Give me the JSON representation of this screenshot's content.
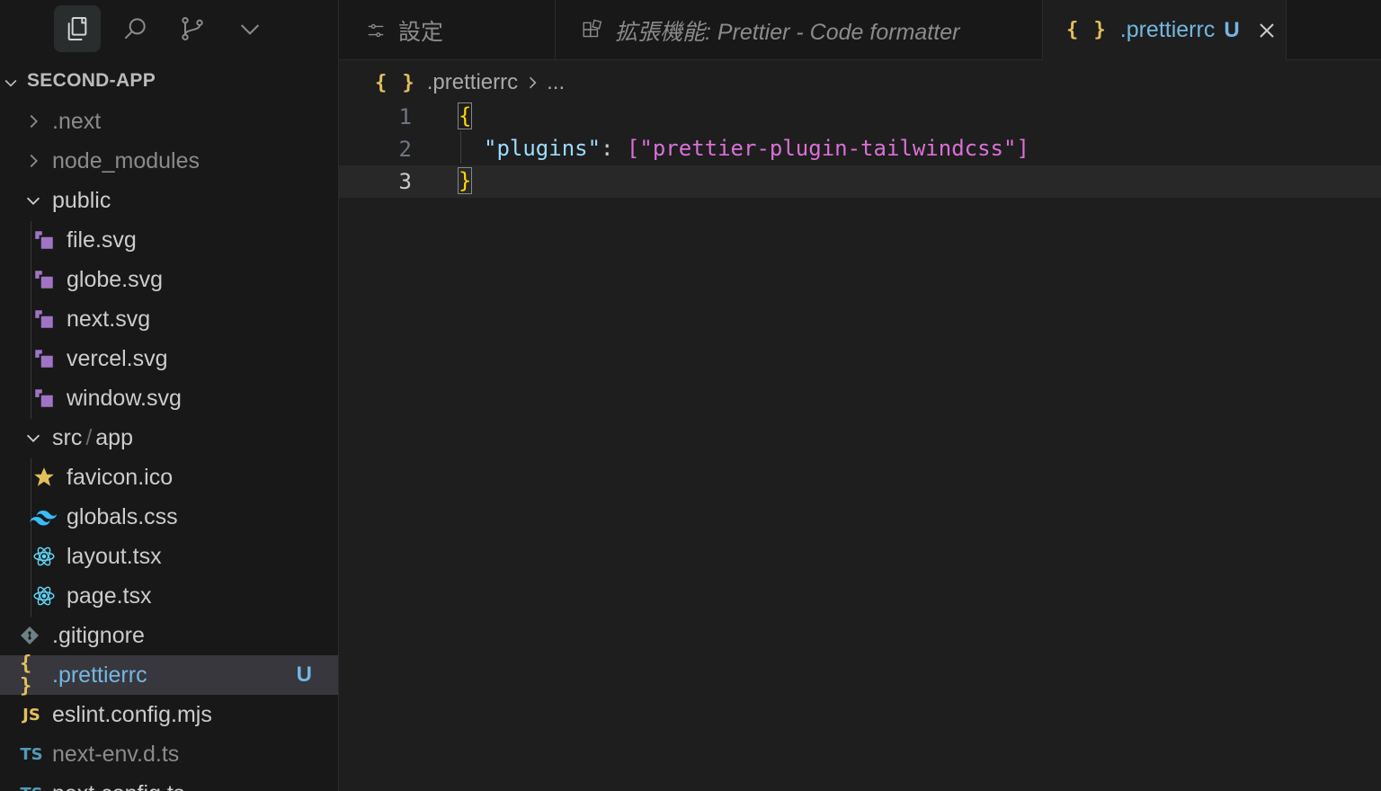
{
  "explorer": {
    "project": "SECOND-APP",
    "items": [
      {
        "label": ".next",
        "type": "folder-collapsed"
      },
      {
        "label": "node_modules",
        "type": "folder-collapsed"
      },
      {
        "label": "public",
        "type": "folder-expanded"
      },
      {
        "label": "file.svg",
        "type": "svg"
      },
      {
        "label": "globe.svg",
        "type": "svg"
      },
      {
        "label": "next.svg",
        "type": "svg"
      },
      {
        "label": "vercel.svg",
        "type": "svg"
      },
      {
        "label": "window.svg",
        "type": "svg"
      },
      {
        "label": "src",
        "label2": "app",
        "sep": "/",
        "type": "folder-expanded"
      },
      {
        "label": "favicon.ico",
        "type": "star"
      },
      {
        "label": "globals.css",
        "type": "tailwind"
      },
      {
        "label": "layout.tsx",
        "type": "react"
      },
      {
        "label": "page.tsx",
        "type": "react"
      },
      {
        "label": ".gitignore",
        "type": "git"
      },
      {
        "label": ".prettierrc",
        "type": "json",
        "badge": "U",
        "selected": true
      },
      {
        "label": "eslint.config.mjs",
        "type": "js"
      },
      {
        "label": "next-env.d.ts",
        "type": "ts"
      },
      {
        "label": "next.config.ts",
        "type": "ts"
      }
    ],
    "icons": {
      "js": "JS",
      "ts": "TS",
      "json": "{ }"
    }
  },
  "tabs": [
    {
      "label": "設定",
      "icon": "settings-sliders-icon"
    },
    {
      "label": "拡張機能: Prettier - Code formatter",
      "icon": "extensions-icon",
      "preview": true
    },
    {
      "label": ".prettierrc",
      "icon": "json-icon",
      "badge": "U",
      "active": true
    }
  ],
  "breadcrumb": {
    "file": ".prettierrc",
    "more": "..."
  },
  "editor": {
    "lines": [
      {
        "n": "1",
        "open": "{"
      },
      {
        "n": "2",
        "key": "\"plugins\"",
        "colon": ": ",
        "lb": "[",
        "str": "\"prettier-plugin-tailwindcss\"",
        "rb": "]"
      },
      {
        "n": "3",
        "close": "}"
      }
    ]
  },
  "colors": {
    "accent_blue": "#73b7e0",
    "json_yellow": "#e2c05c",
    "svg_purple": "#a074c4",
    "react_blue": "#61dafb",
    "tailwind": "#38bdf8"
  }
}
